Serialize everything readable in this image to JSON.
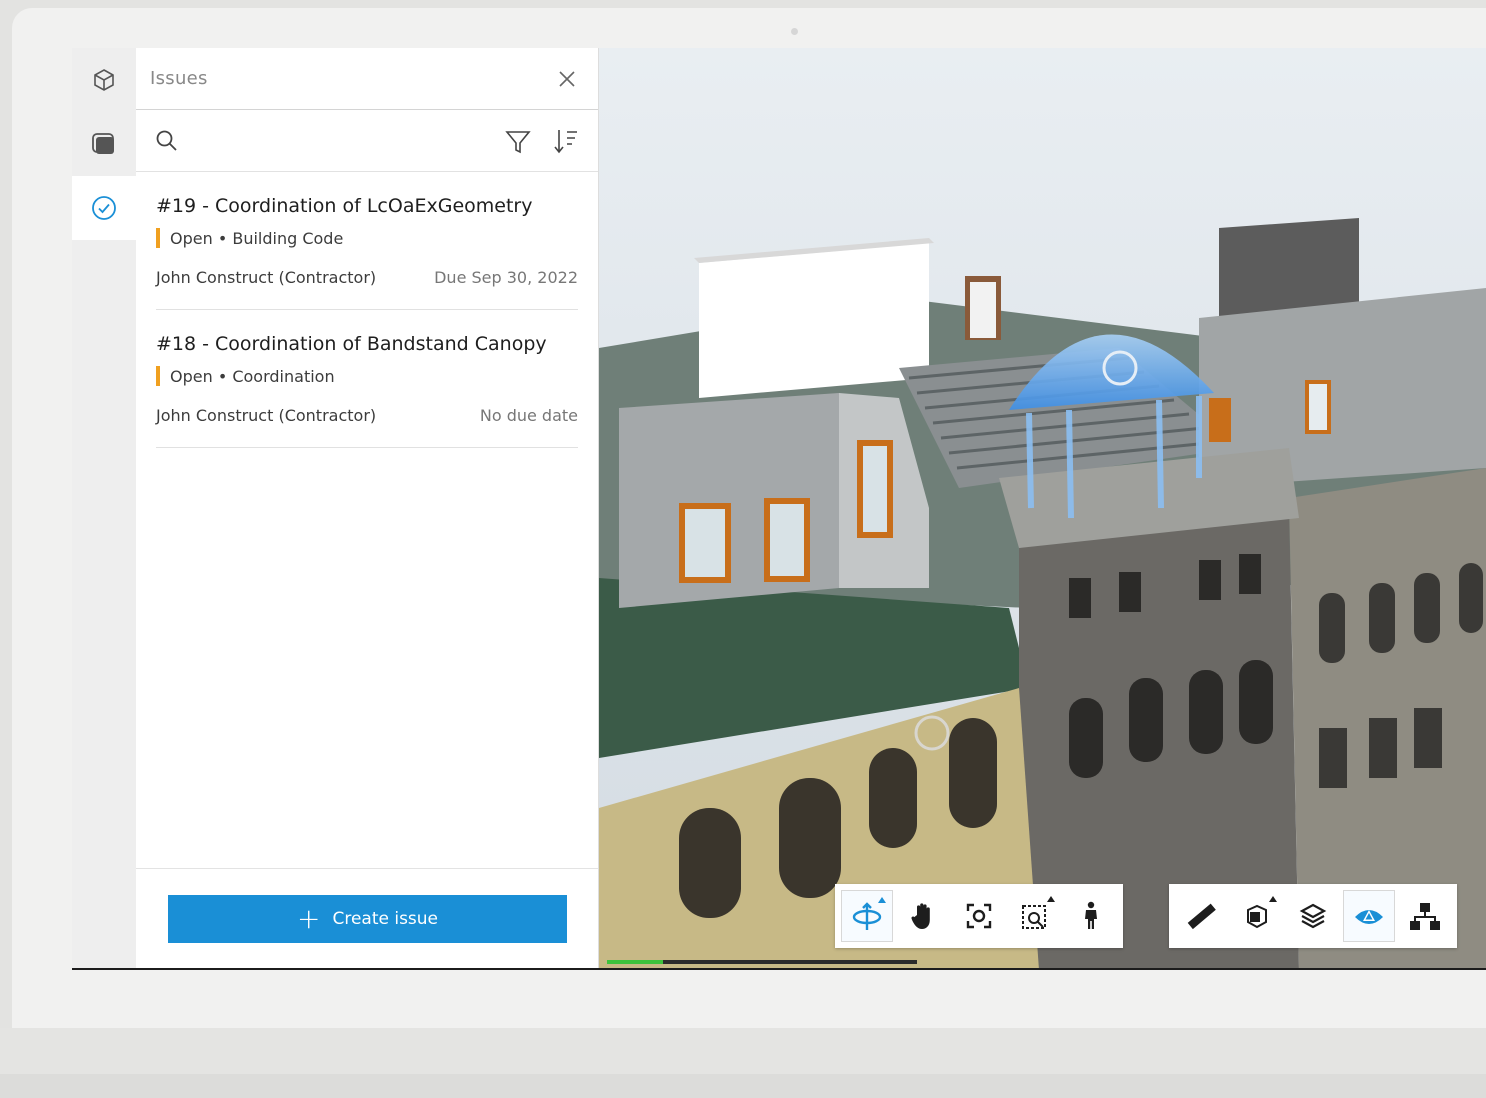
{
  "panel": {
    "title": "Issues",
    "search_icon": "search-icon",
    "filter_icon": "filter-icon",
    "sort_icon": "sort-icon",
    "close_icon": "close-icon"
  },
  "rail": [
    {
      "icon": "model-cube-icon",
      "active": false
    },
    {
      "icon": "layers-stack-icon",
      "active": false
    },
    {
      "icon": "issues-check-icon",
      "active": true
    }
  ],
  "issues": [
    {
      "title": "#19 - Coordination of LcOaExGeometry",
      "status": "Open",
      "type": "Building Code",
      "assignee": "John Construct (Contractor)",
      "due": "Due Sep 30, 2022"
    },
    {
      "title": "#18 - Coordination of Bandstand Canopy",
      "status": "Open",
      "type": "Coordination",
      "assignee": "John Construct (Contractor)",
      "due": "No due date"
    }
  ],
  "create_button": {
    "label": "Create issue",
    "icon": "plus-icon"
  },
  "viewer": {
    "load_progress": 0.18,
    "navigation_tools": [
      "orbit-icon",
      "pan-icon",
      "focus-icon",
      "zoom-window-icon",
      "first-person-icon"
    ],
    "analysis_tools": [
      "measure-icon",
      "section-icon",
      "layers-icon",
      "reality-capture-icon",
      "model-browser-icon"
    ]
  },
  "colors": {
    "accent": "#1a8fd6",
    "status_open": "#f0a020",
    "progress": "#3cc23c"
  }
}
